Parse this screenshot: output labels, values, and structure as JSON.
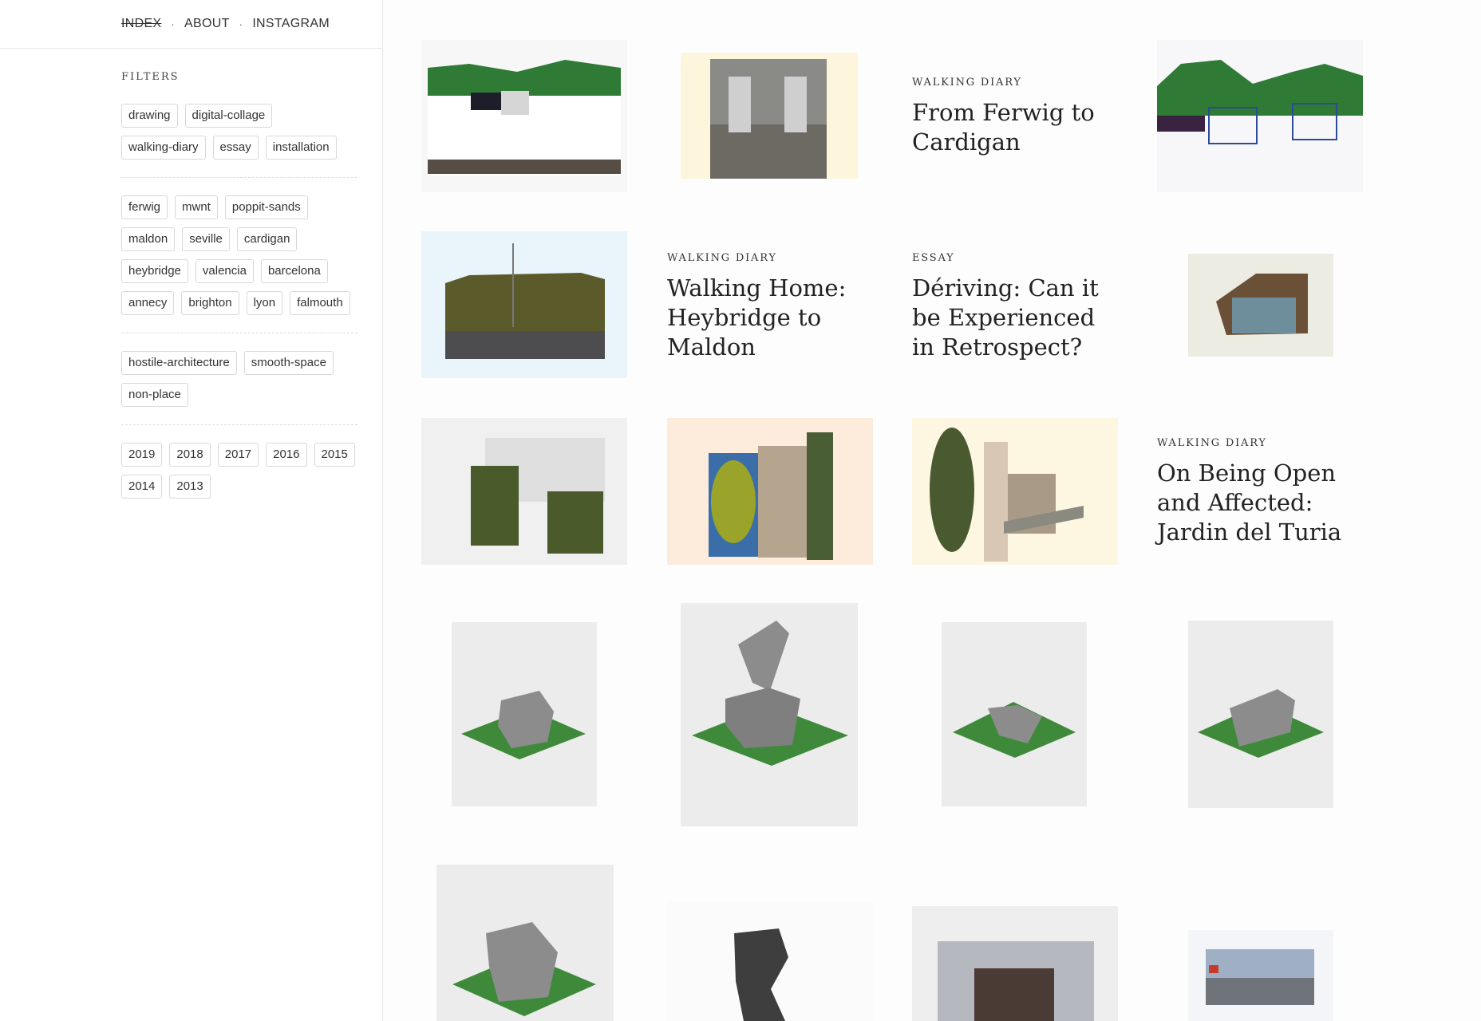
{
  "nav": {
    "items": [
      {
        "label": "INDEX"
      },
      {
        "label": "ABOUT"
      },
      {
        "label": "INSTAGRAM"
      }
    ]
  },
  "filters": {
    "title": "FILTERS",
    "groups": [
      [
        "drawing",
        "digital-collage",
        "walking-diary",
        "essay",
        "installation"
      ],
      [
        "ferwig",
        "mwnt",
        "poppit-sands",
        "maldon",
        "seville",
        "cardigan",
        "heybridge",
        "valencia",
        "barcelona",
        "annecy",
        "brighton",
        "lyon",
        "falmouth"
      ],
      [
        "hostile-architecture",
        "smooth-space",
        "non-place"
      ],
      [
        "2019",
        "2018",
        "2017",
        "2016",
        "2015",
        "2014",
        "2013"
      ]
    ]
  },
  "posts": {
    "p1": {
      "category": "WALKING DIARY",
      "title": "From Ferwig to Cardigan"
    },
    "p2": {
      "category": "WALKING DIARY",
      "title": "Walking Home: Heybridge to Maldon"
    },
    "p3": {
      "category": "ESSAY",
      "title": "Dériving: Can it be Experienced in Retrospect?"
    },
    "p4": {
      "category": "WALKING DIARY",
      "title": "On Being Open and Affected: Jardin del Turia"
    }
  },
  "colors": {
    "grass": "#3f8a3a",
    "hill": "#2f7a35",
    "stone": "#8c8c8c",
    "cream": "#fdf6dc",
    "peach": "#fdebdc",
    "skyblue": "#e9f4fb"
  }
}
